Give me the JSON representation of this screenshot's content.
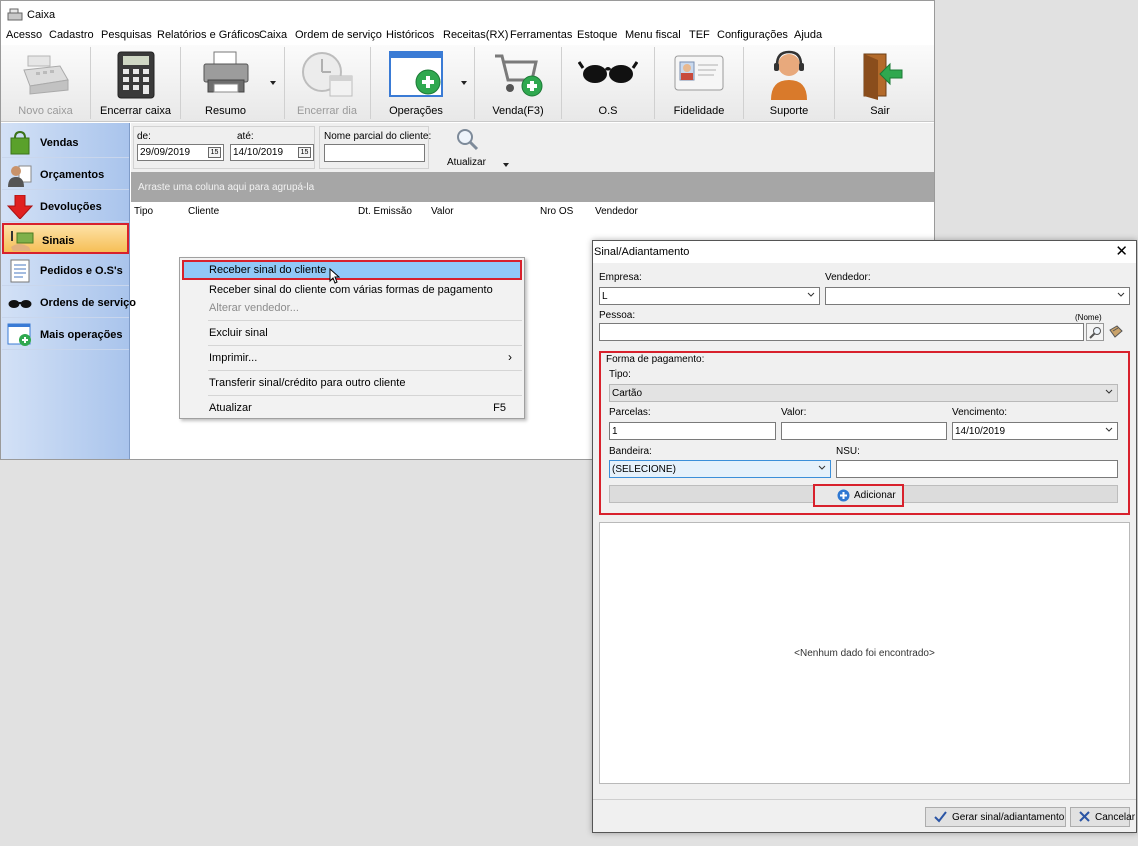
{
  "main_window": {
    "title": "Caixa",
    "menu": [
      "Acesso",
      "Cadastro",
      "Pesquisas",
      "Relatórios e Gráficos",
      "Caixa",
      "Ordem de serviço",
      "Históricos",
      "Receitas(RX)",
      "Ferramentas",
      "Estoque",
      "Menu fiscal",
      "TEF",
      "Configurações",
      "Ajuda"
    ],
    "toolbar": [
      "Novo caixa",
      "Encerrar caixa",
      "Resumo",
      "Encerrar dia",
      "Operações",
      "Venda(F3)",
      "O.S",
      "Fidelidade",
      "Suporte",
      "Sair"
    ],
    "sidebar": [
      "Vendas",
      "Orçamentos",
      "Devoluções",
      "Sinais",
      "Pedidos e O.S's",
      "Ordens de serviço",
      "Mais operações"
    ],
    "filters": {
      "from_label": "de:",
      "from_date": "29/09/2019",
      "to_label": "até:",
      "to_date": "14/10/2019",
      "client_label": "Nome parcial do cliente:",
      "client_value": "",
      "refresh_label": "Atualizar",
      "calendar_glyph": "15"
    },
    "group_panel_text": "Arraste uma coluna aqui para agrupá-la",
    "grid_columns": [
      "Tipo",
      "Cliente",
      "Dt. Emissão",
      "Valor",
      "Nro OS",
      "Vendedor"
    ],
    "context_menu": {
      "receber": "Receber sinal do cliente",
      "receber_varias": "Receber sinal do cliente com várias formas de pagamento",
      "alterar_vendedor": "Alterar vendedor...",
      "excluir": "Excluir sinal",
      "imprimir": "Imprimir...",
      "transferir": "Transferir sinal/crédito para outro cliente",
      "atualizar": "Atualizar",
      "atualizar_shortcut": "F5",
      "submenu_arrow": "›"
    }
  },
  "dialog": {
    "title": "Sinal/Adiantamento",
    "close": "✕",
    "empresa_label": "Empresa:",
    "empresa_value": "L",
    "vendedor_label": "Vendedor:",
    "vendedor_value": "",
    "pessoa_label": "Pessoa:",
    "pessoa_hint": "(Nome)",
    "pessoa_value": "",
    "forma_pagamento_label": "Forma de pagamento:",
    "tipo_label": "Tipo:",
    "tipo_value": "Cartão",
    "parcelas_label": "Parcelas:",
    "parcelas_value": "1",
    "valor_label": "Valor:",
    "valor_value": "",
    "vencimento_label": "Vencimento:",
    "vencimento_value": "14/10/2019",
    "bandeira_label": "Bandeira:",
    "bandeira_value": "(SELECIONE)",
    "nsu_label": "NSU:",
    "nsu_value": "",
    "adicionar_label": "Adicionar",
    "empty_grid_text": "<Nenhum dado foi encontrado>",
    "gerar_label": "Gerar sinal/adiantamento",
    "cancelar_label": "Cancelar"
  },
  "colors": {
    "highlight_red": "#d8212c",
    "menu_selection": "#91c9f7",
    "sidebar_top": "#d3e1f6",
    "sidebar_bottom": "#a9c4ec",
    "group_panel": "#a6a6a6"
  }
}
